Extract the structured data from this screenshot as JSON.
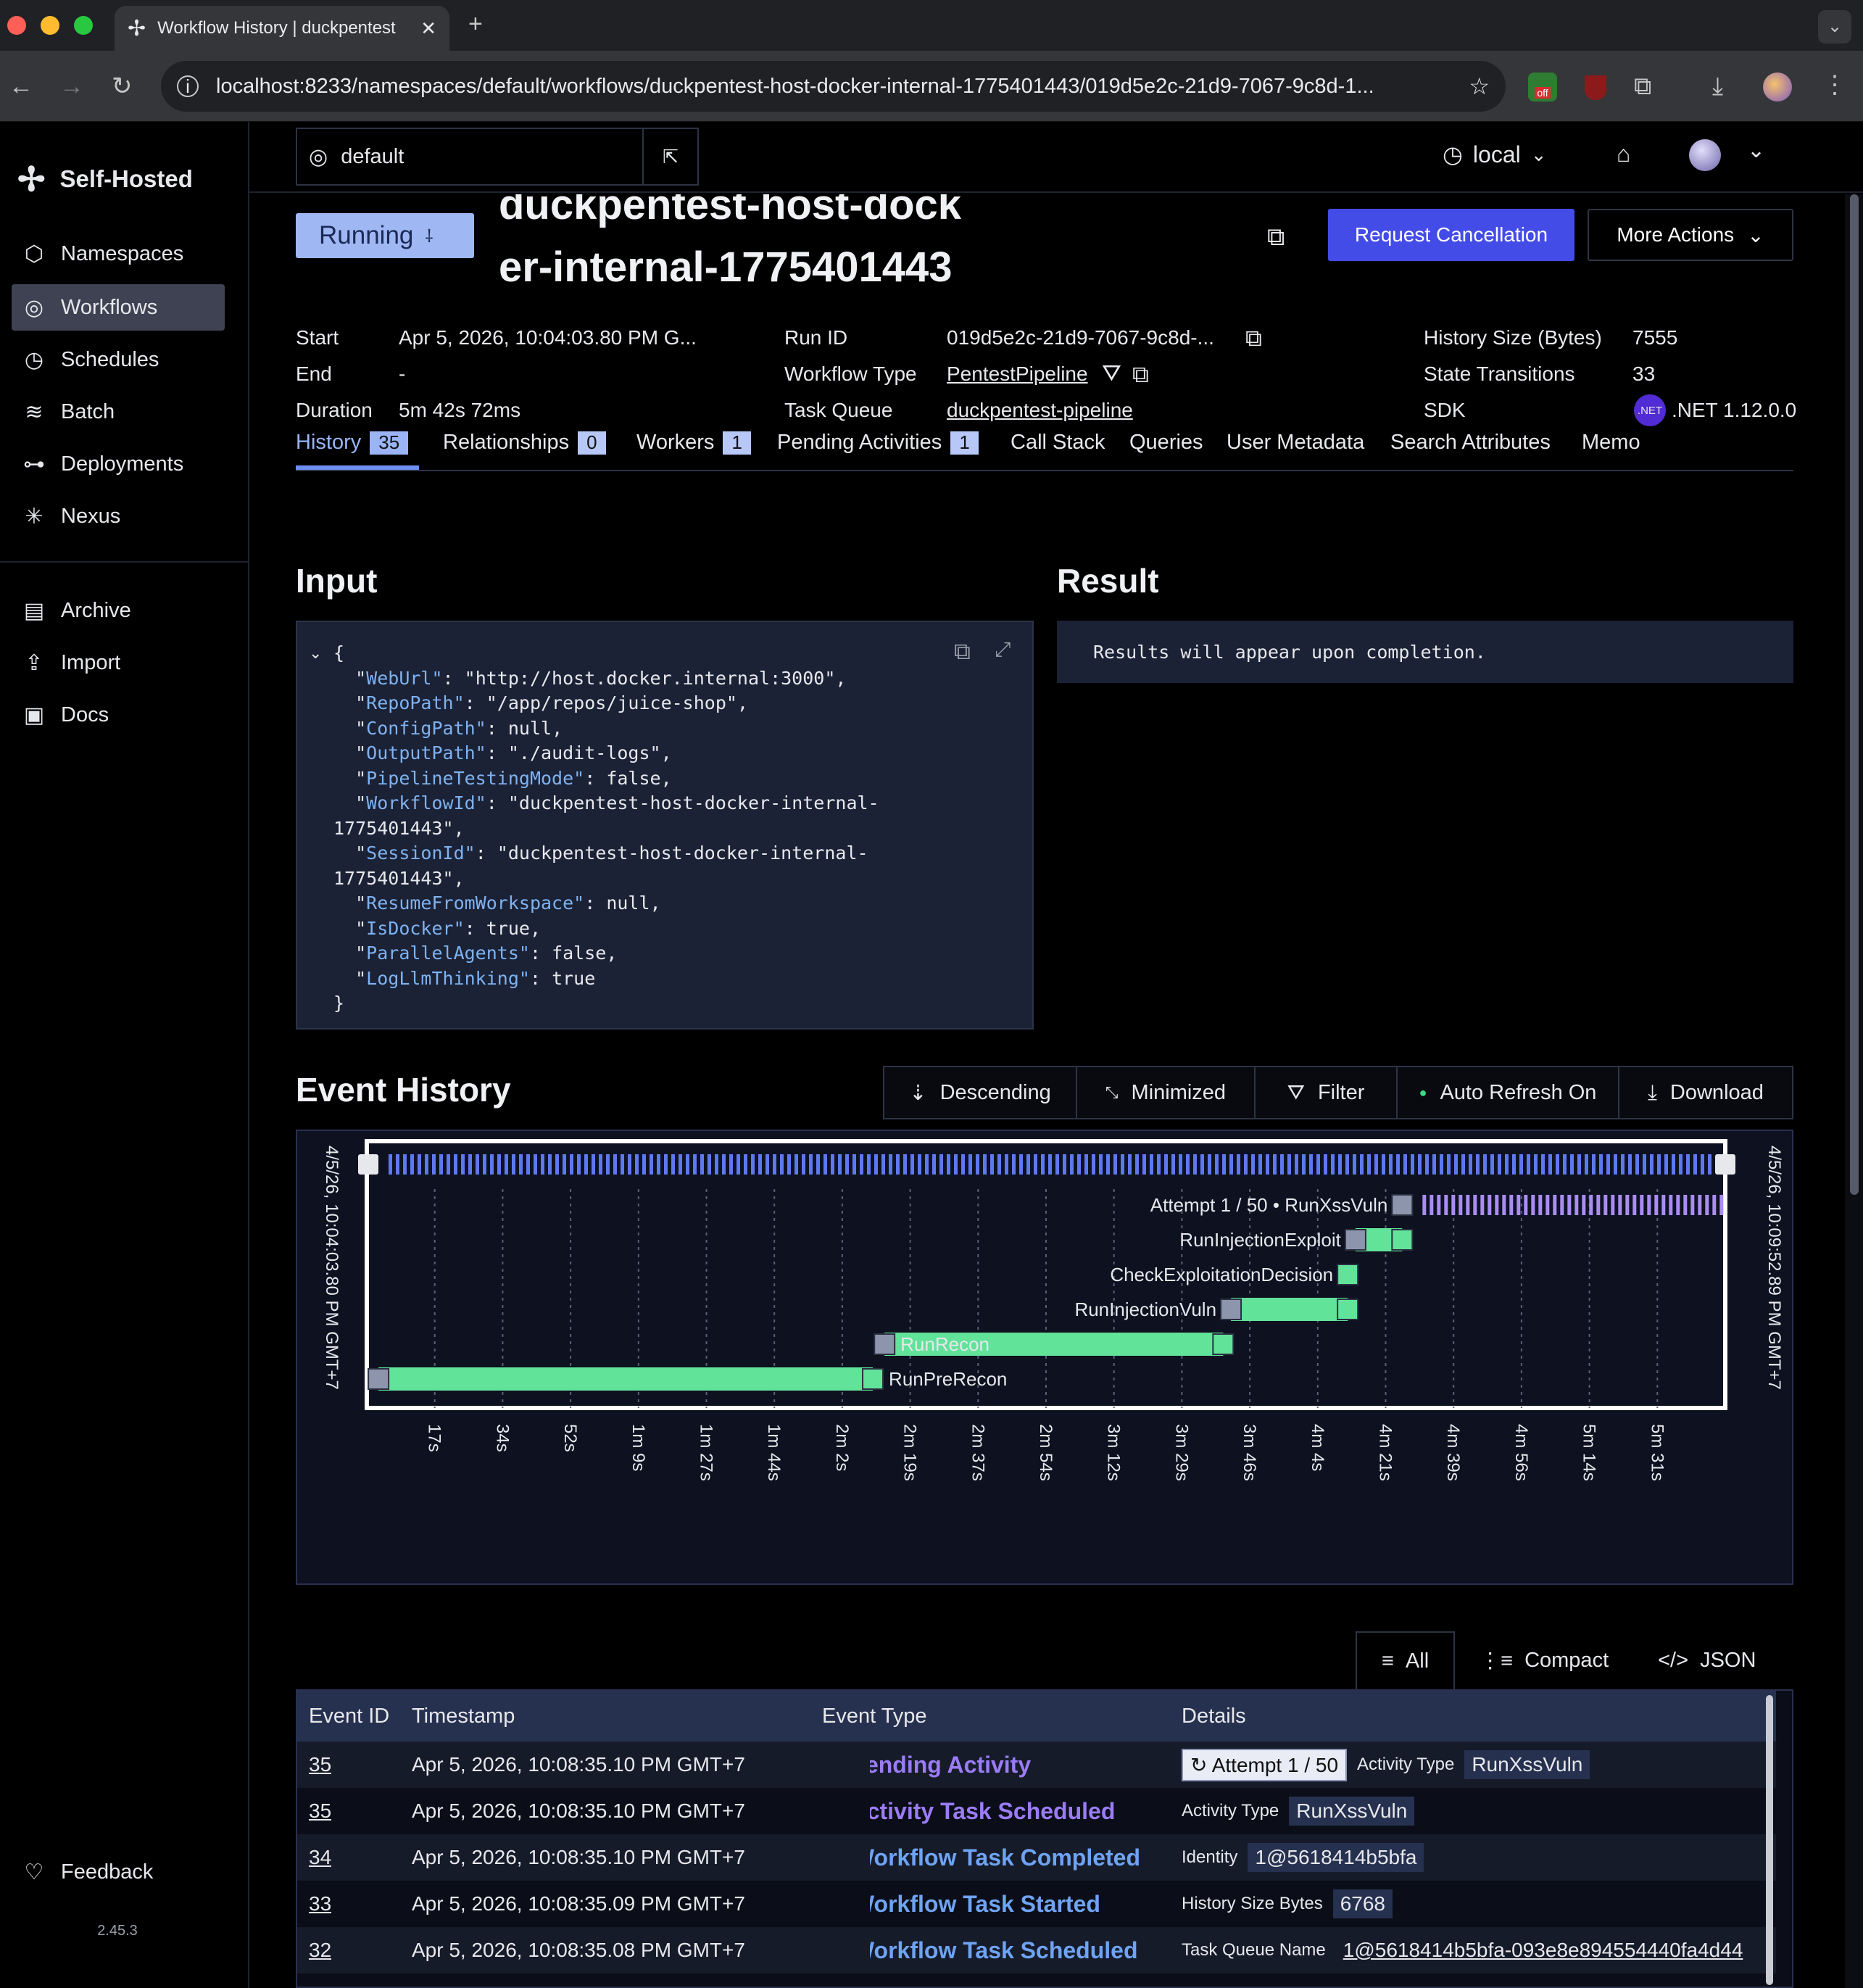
{
  "browser": {
    "tab_title": "Workflow History | duckpentest",
    "url": "localhost:8233/namespaces/default/workflows/duckpentest-host-docker-internal-1775401443/019d5e2c-21d9-7067-9c8d-1...",
    "extension_badge": "off"
  },
  "sidebar": {
    "brand": "Self-Hosted",
    "items": [
      {
        "label": "Namespaces",
        "icon": "cube-icon"
      },
      {
        "label": "Workflows",
        "icon": "workflow-icon",
        "active": true
      },
      {
        "label": "Schedules",
        "icon": "clock-icon"
      },
      {
        "label": "Batch",
        "icon": "layers-icon"
      },
      {
        "label": "Deployments",
        "icon": "deploy-icon"
      },
      {
        "label": "Nexus",
        "icon": "nexus-icon"
      }
    ],
    "items2": [
      {
        "label": "Archive",
        "icon": "archive-icon"
      },
      {
        "label": "Import",
        "icon": "upload-icon"
      },
      {
        "label": "Docs",
        "icon": "docs-icon"
      }
    ],
    "feedback": "Feedback",
    "version": "2.45.3"
  },
  "topbar": {
    "namespace": "default",
    "env": "local"
  },
  "workflow": {
    "status": "Running",
    "title": "duckpentest-host-docker-internal-1775401443",
    "cancel": "Request Cancellation",
    "more": "More Actions",
    "start_label": "Start",
    "start": "Apr 5, 2026, 10:04:03.80 PM G...",
    "end_label": "End",
    "end": "-",
    "duration_label": "Duration",
    "duration": "5m 42s 72ms",
    "runid_label": "Run ID",
    "runid": "019d5e2c-21d9-7067-9c8d-...",
    "type_label": "Workflow Type",
    "type": "PentestPipeline",
    "queue_label": "Task Queue",
    "queue": "duckpentest-pipeline",
    "hsize_label": "History Size (Bytes)",
    "hsize": "7555",
    "trans_label": "State Transitions",
    "trans": "33",
    "sdk_label": "SDK",
    "sdk_badge": ".NET",
    "sdk": ".NET 1.12.0.0"
  },
  "tabs": [
    {
      "label": "History",
      "count": "35"
    },
    {
      "label": "Relationships",
      "count": "0"
    },
    {
      "label": "Workers",
      "count": "1"
    },
    {
      "label": "Pending Activities",
      "count": "1"
    },
    {
      "label": "Call Stack"
    },
    {
      "label": "Queries"
    },
    {
      "label": "User Metadata"
    },
    {
      "label": "Search Attributes"
    },
    {
      "label": "Memo"
    }
  ],
  "input": {
    "title": "Input",
    "lines": [
      {
        "k": "WebUrl",
        "v": "\"http://host.docker.internal:3000\","
      },
      {
        "k": "RepoPath",
        "v": "\"/app/repos/juice-shop\","
      },
      {
        "k": "ConfigPath",
        "v": "null,"
      },
      {
        "k": "OutputPath",
        "v": "\"./audit-logs\","
      },
      {
        "k": "PipelineTestingMode",
        "v": "false,"
      },
      {
        "k": "WorkflowId",
        "v": "\"duckpentest-host-docker-internal-",
        "cont": "1775401443\","
      },
      {
        "k": "SessionId",
        "v": "\"duckpentest-host-docker-internal-",
        "cont": "1775401443\","
      },
      {
        "k": "ResumeFromWorkspace",
        "v": "null,"
      },
      {
        "k": "IsDocker",
        "v": "true,"
      },
      {
        "k": "ParallelAgents",
        "v": "false,"
      },
      {
        "k": "LogLlmThinking",
        "v": "true"
      }
    ]
  },
  "result": {
    "title": "Result",
    "text": "Results will appear upon completion."
  },
  "event_history": {
    "title": "Event History",
    "buttons": [
      "Descending",
      "Minimized",
      "Filter",
      "Auto Refresh On",
      "Download"
    ]
  },
  "timeline": {
    "start_label": "4/5/26, 10:04:03.80 PM GMT+7",
    "end_label": "4/5/26, 10:09:52.89 PM GMT+7",
    "ticks": [
      "17s",
      "34s",
      "52s",
      "1m 9s",
      "1m 27s",
      "1m 44s",
      "2m 2s",
      "2m 19s",
      "2m 37s",
      "2m 54s",
      "3m 12s",
      "3m 29s",
      "3m 46s",
      "4m 4s",
      "4m 21s",
      "4m 39s",
      "4m 56s",
      "5m 14s",
      "5m 31s"
    ],
    "total_seconds": 349,
    "activities": [
      {
        "name": "RunPreRecon",
        "start": 3,
        "end": 130,
        "status": "completed"
      },
      {
        "name": "RunRecon",
        "start": 133,
        "end": 220,
        "status": "completed"
      },
      {
        "name": "RunInjectionVuln",
        "start": 222,
        "end": 252,
        "status": "completed"
      },
      {
        "name": "CheckExploitationDecision",
        "start": 252,
        "end": 252,
        "status": "completed"
      },
      {
        "name": "RunInjectionExploit",
        "start": 254,
        "end": 266,
        "status": "completed"
      },
      {
        "name": "Attempt 1 / 50 • RunXssVuln",
        "start": 266,
        "end": 349,
        "status": "pending"
      }
    ]
  },
  "views": [
    "All",
    "Compact",
    "JSON"
  ],
  "events": {
    "headers": [
      "Event ID",
      "Timestamp",
      "Event Type",
      "Details"
    ],
    "rows": [
      {
        "id": "35",
        "ts": "Apr 5, 2026, 10:08:35.10 PM GMT+7",
        "type": "Pending Activity",
        "color": "#9b7cf7",
        "icon": "diamond-icon",
        "d1": "Attempt 1 / 50",
        "dk": "Activity Type",
        "dv": "RunXssVuln"
      },
      {
        "id": "35",
        "ts": "Apr 5, 2026, 10:08:35.10 PM GMT+7",
        "type": "Activity Task Scheduled",
        "color": "#9b7cf7",
        "icon": "diamond-icon",
        "dk": "Activity Type",
        "dv": "RunXssVuln"
      },
      {
        "id": "34",
        "ts": "Apr 5, 2026, 10:08:35.10 PM GMT+7",
        "type": "Workflow Task Completed",
        "color": "#6fa3f3",
        "icon": "workflow-icon",
        "dk": "Identity",
        "dv": "1@5618414b5bfa"
      },
      {
        "id": "33",
        "ts": "Apr 5, 2026, 10:08:35.09 PM GMT+7",
        "type": "Workflow Task Started",
        "color": "#6fa3f3",
        "icon": "workflow-icon",
        "dk": "History Size Bytes",
        "dv": "6768"
      },
      {
        "id": "32",
        "ts": "Apr 5, 2026, 10:08:35.08 PM GMT+7",
        "type": "Workflow Task Scheduled",
        "color": "#6fa3f3",
        "icon": "workflow-icon",
        "dk": "Task Queue Name",
        "dv": "1@5618414b5bfa-093e8e894554440fa4d44"
      }
    ]
  }
}
